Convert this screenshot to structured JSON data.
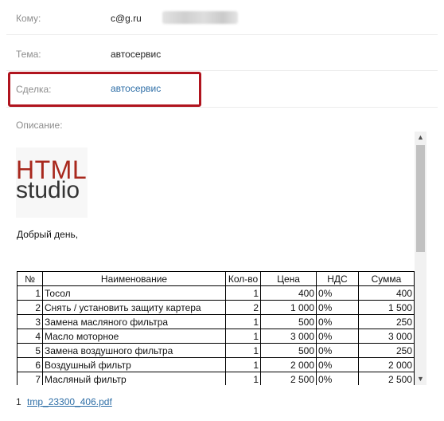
{
  "fields": {
    "to_label": "Кому:",
    "to_value": "c@g.ru",
    "subject_label": "Тема:",
    "subject_value": "автосервис",
    "deal_label": "Сделка:",
    "deal_value": "автосервис",
    "description_label": "Описание:"
  },
  "body": {
    "logo_line1": "HTML",
    "logo_line2": "studio",
    "greeting": "Добрый день,"
  },
  "table": {
    "headers": [
      "№",
      "Наименование",
      "Кол-во",
      "Цена",
      "НДС",
      "Сумма"
    ],
    "rows": [
      [
        "1",
        "Тосол",
        "1",
        "400",
        "0%",
        "400"
      ],
      [
        "2",
        "Снять / установить защиту картера",
        "2",
        "1 000",
        "0%",
        "1 500"
      ],
      [
        "3",
        "Замена масляного фильтра",
        "1",
        "500",
        "0%",
        "250"
      ],
      [
        "4",
        "Масло моторное",
        "1",
        "3 000",
        "0%",
        "3 000"
      ],
      [
        "5",
        "Замена воздушного фильтра",
        "1",
        "500",
        "0%",
        "250"
      ],
      [
        "6",
        "Воздушный фильтр",
        "1",
        "2 000",
        "0%",
        "2 000"
      ],
      [
        "7",
        "Масляный фильтр",
        "1",
        "2 500",
        "0%",
        "2 500"
      ]
    ]
  },
  "attachments": {
    "count": "1",
    "file_name": "tmp_23300_406.pdf"
  },
  "icons": {
    "scroll_up": "chevron-up-icon",
    "scroll_down": "chevron-down-icon"
  },
  "colors": {
    "highlight": "#b0141e",
    "link": "#2f6fa7",
    "logo_red": "#a8281d"
  }
}
